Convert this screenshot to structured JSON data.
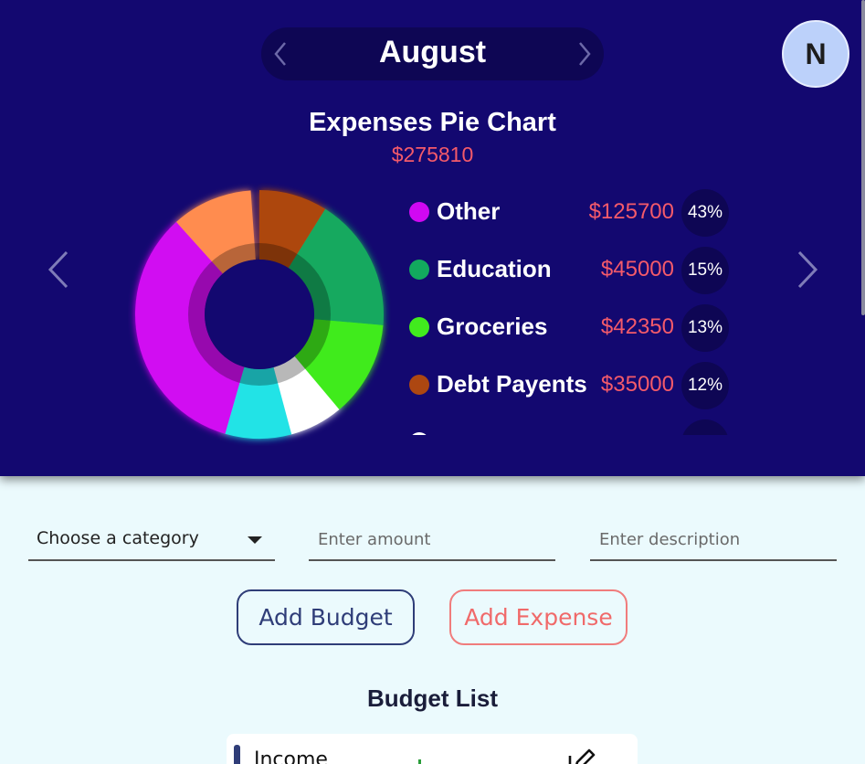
{
  "header": {
    "month": "August",
    "avatar_initial": "N"
  },
  "chart_header": {
    "title": "Expenses Pie Chart",
    "total": "$275810"
  },
  "chart_data": {
    "type": "pie",
    "title": "Expenses Pie Chart",
    "slices": [
      {
        "name": "Other",
        "value": 125700,
        "amount_label": "$125700",
        "percent_label": "43%",
        "color": "#d108f2"
      },
      {
        "name": "Education",
        "value": 45000,
        "amount_label": "$45000",
        "percent_label": "15%",
        "color": "#12a95e"
      },
      {
        "name": "Groceries",
        "value": 42350,
        "amount_label": "$42350",
        "percent_label": "13%",
        "color": "#41eb1e"
      },
      {
        "name": "Debt Payents",
        "value": 35000,
        "amount_label": "$35000",
        "percent_label": "12%",
        "color": "#ad4711"
      },
      {
        "name": "",
        "value": 0,
        "color": "#ff8c4f"
      },
      {
        "name": "",
        "value": 0,
        "color": "#ffffff"
      },
      {
        "name": "",
        "value": 0,
        "color": "#21e3e6"
      }
    ],
    "visible_slice_angles_deg": []
  },
  "form": {
    "category_value": "Choose a category",
    "amount_placeholder": "Enter amount",
    "description_placeholder": "Enter description",
    "add_budget_label": "Add Budget",
    "add_expense_label": "Add Expense"
  },
  "budget_list": {
    "title": "Budget List",
    "items": [
      {
        "name": "Income"
      }
    ]
  },
  "colors": {
    "hero_bg": "#130870",
    "accent_red": "#f45a6a",
    "navy": "#2f3d78",
    "page_bg": "#ebfafd"
  }
}
